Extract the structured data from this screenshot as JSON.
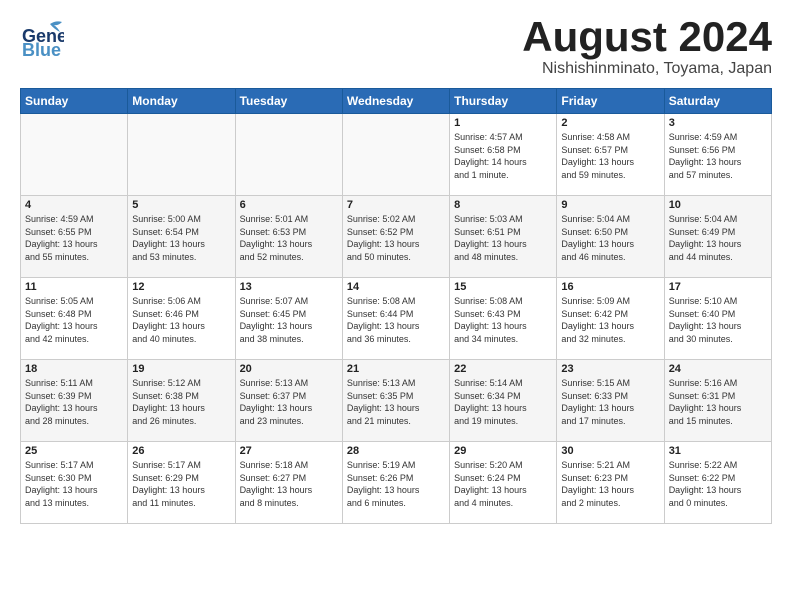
{
  "header": {
    "logo_general": "General",
    "logo_blue": "Blue",
    "month_title": "August 2024",
    "location": "Nishishinminato, Toyama, Japan"
  },
  "weekdays": [
    "Sunday",
    "Monday",
    "Tuesday",
    "Wednesday",
    "Thursday",
    "Friday",
    "Saturday"
  ],
  "weeks": [
    [
      {
        "day": "",
        "info": ""
      },
      {
        "day": "",
        "info": ""
      },
      {
        "day": "",
        "info": ""
      },
      {
        "day": "",
        "info": ""
      },
      {
        "day": "1",
        "info": "Sunrise: 4:57 AM\nSunset: 6:58 PM\nDaylight: 14 hours\nand 1 minute."
      },
      {
        "day": "2",
        "info": "Sunrise: 4:58 AM\nSunset: 6:57 PM\nDaylight: 13 hours\nand 59 minutes."
      },
      {
        "day": "3",
        "info": "Sunrise: 4:59 AM\nSunset: 6:56 PM\nDaylight: 13 hours\nand 57 minutes."
      }
    ],
    [
      {
        "day": "4",
        "info": "Sunrise: 4:59 AM\nSunset: 6:55 PM\nDaylight: 13 hours\nand 55 minutes."
      },
      {
        "day": "5",
        "info": "Sunrise: 5:00 AM\nSunset: 6:54 PM\nDaylight: 13 hours\nand 53 minutes."
      },
      {
        "day": "6",
        "info": "Sunrise: 5:01 AM\nSunset: 6:53 PM\nDaylight: 13 hours\nand 52 minutes."
      },
      {
        "day": "7",
        "info": "Sunrise: 5:02 AM\nSunset: 6:52 PM\nDaylight: 13 hours\nand 50 minutes."
      },
      {
        "day": "8",
        "info": "Sunrise: 5:03 AM\nSunset: 6:51 PM\nDaylight: 13 hours\nand 48 minutes."
      },
      {
        "day": "9",
        "info": "Sunrise: 5:04 AM\nSunset: 6:50 PM\nDaylight: 13 hours\nand 46 minutes."
      },
      {
        "day": "10",
        "info": "Sunrise: 5:04 AM\nSunset: 6:49 PM\nDaylight: 13 hours\nand 44 minutes."
      }
    ],
    [
      {
        "day": "11",
        "info": "Sunrise: 5:05 AM\nSunset: 6:48 PM\nDaylight: 13 hours\nand 42 minutes."
      },
      {
        "day": "12",
        "info": "Sunrise: 5:06 AM\nSunset: 6:46 PM\nDaylight: 13 hours\nand 40 minutes."
      },
      {
        "day": "13",
        "info": "Sunrise: 5:07 AM\nSunset: 6:45 PM\nDaylight: 13 hours\nand 38 minutes."
      },
      {
        "day": "14",
        "info": "Sunrise: 5:08 AM\nSunset: 6:44 PM\nDaylight: 13 hours\nand 36 minutes."
      },
      {
        "day": "15",
        "info": "Sunrise: 5:08 AM\nSunset: 6:43 PM\nDaylight: 13 hours\nand 34 minutes."
      },
      {
        "day": "16",
        "info": "Sunrise: 5:09 AM\nSunset: 6:42 PM\nDaylight: 13 hours\nand 32 minutes."
      },
      {
        "day": "17",
        "info": "Sunrise: 5:10 AM\nSunset: 6:40 PM\nDaylight: 13 hours\nand 30 minutes."
      }
    ],
    [
      {
        "day": "18",
        "info": "Sunrise: 5:11 AM\nSunset: 6:39 PM\nDaylight: 13 hours\nand 28 minutes."
      },
      {
        "day": "19",
        "info": "Sunrise: 5:12 AM\nSunset: 6:38 PM\nDaylight: 13 hours\nand 26 minutes."
      },
      {
        "day": "20",
        "info": "Sunrise: 5:13 AM\nSunset: 6:37 PM\nDaylight: 13 hours\nand 23 minutes."
      },
      {
        "day": "21",
        "info": "Sunrise: 5:13 AM\nSunset: 6:35 PM\nDaylight: 13 hours\nand 21 minutes."
      },
      {
        "day": "22",
        "info": "Sunrise: 5:14 AM\nSunset: 6:34 PM\nDaylight: 13 hours\nand 19 minutes."
      },
      {
        "day": "23",
        "info": "Sunrise: 5:15 AM\nSunset: 6:33 PM\nDaylight: 13 hours\nand 17 minutes."
      },
      {
        "day": "24",
        "info": "Sunrise: 5:16 AM\nSunset: 6:31 PM\nDaylight: 13 hours\nand 15 minutes."
      }
    ],
    [
      {
        "day": "25",
        "info": "Sunrise: 5:17 AM\nSunset: 6:30 PM\nDaylight: 13 hours\nand 13 minutes."
      },
      {
        "day": "26",
        "info": "Sunrise: 5:17 AM\nSunset: 6:29 PM\nDaylight: 13 hours\nand 11 minutes."
      },
      {
        "day": "27",
        "info": "Sunrise: 5:18 AM\nSunset: 6:27 PM\nDaylight: 13 hours\nand 8 minutes."
      },
      {
        "day": "28",
        "info": "Sunrise: 5:19 AM\nSunset: 6:26 PM\nDaylight: 13 hours\nand 6 minutes."
      },
      {
        "day": "29",
        "info": "Sunrise: 5:20 AM\nSunset: 6:24 PM\nDaylight: 13 hours\nand 4 minutes."
      },
      {
        "day": "30",
        "info": "Sunrise: 5:21 AM\nSunset: 6:23 PM\nDaylight: 13 hours\nand 2 minutes."
      },
      {
        "day": "31",
        "info": "Sunrise: 5:22 AM\nSunset: 6:22 PM\nDaylight: 13 hours\nand 0 minutes."
      }
    ]
  ]
}
